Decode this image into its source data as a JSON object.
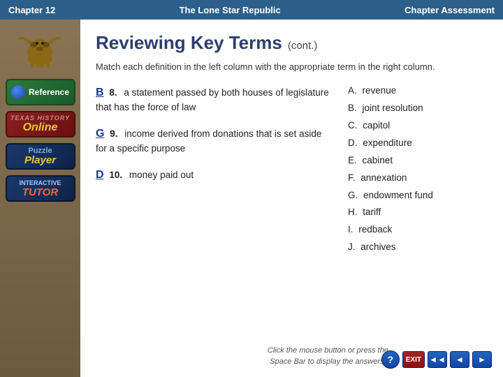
{
  "topbar": {
    "chapter": "Chapter 12",
    "title": "The Lone Star Republic",
    "assessment": "Chapter Assessment"
  },
  "sidebar": {
    "reference_label": "Reference",
    "online_label": "Online",
    "puzzle_label": "Puzzle",
    "player_label": "Player",
    "interactive_label": "Interactive",
    "tutor_label": "TUToR"
  },
  "content": {
    "page_title": "Reviewing Key Terms",
    "page_subtitle": "(cont.)",
    "instructions": "Match each definition in the left column with the appropriate term in the right column.",
    "questions": [
      {
        "letter": "B",
        "number": "8.",
        "text": "a statement passed by both houses of legislature that has the force of law"
      },
      {
        "letter": "G",
        "number": "9.",
        "text": "income derived from donations that is set aside for a specific purpose"
      },
      {
        "letter": "D",
        "number": "10.",
        "text": "money paid out"
      }
    ],
    "answers": [
      {
        "letter": "A.",
        "text": "revenue"
      },
      {
        "letter": "B.",
        "text": "joint resolution"
      },
      {
        "letter": "C.",
        "text": "capitol"
      },
      {
        "letter": "D.",
        "text": "expenditure"
      },
      {
        "letter": "E.",
        "text": "cabinet"
      },
      {
        "letter": "F.",
        "text": "annexation"
      },
      {
        "letter": "G.",
        "text": "endowment fund"
      },
      {
        "letter": "H.",
        "text": "tariff"
      },
      {
        "letter": "I.",
        "text": "redback"
      },
      {
        "letter": "J.",
        "text": "archives"
      }
    ],
    "footer_note": "Click the mouse button or press the\nSpace Bar to display the answers."
  },
  "nav": {
    "question_label": "?",
    "exit_label": "EXIT",
    "back_arrow": "◄◄",
    "prev_arrow": "◄",
    "next_arrow": "►"
  }
}
